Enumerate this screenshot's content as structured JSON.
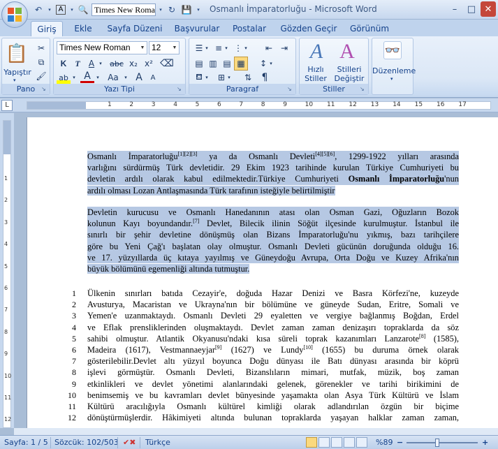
{
  "window": {
    "title": "Osmanlı İmparatorluğu - Microsoft Word",
    "qat_font": "Times New Roman",
    "minimize": "–",
    "maximize": "□",
    "close": "✕"
  },
  "tabs": [
    "Giriş",
    "Ekle",
    "Sayfa Düzeni",
    "Başvurular",
    "Postalar",
    "Gözden Geçir",
    "Görünüm"
  ],
  "ribbon": {
    "pano": {
      "label": "Pano",
      "paste": "Yapıştır"
    },
    "font": {
      "label": "Yazı Tipi",
      "name": "Times New Roman",
      "size": "12",
      "bold": "K",
      "italic": "T",
      "underline": "A",
      "strike": "abc",
      "sub": "x₂",
      "sup": "x²",
      "grow": "A",
      "shrink": "A",
      "case": "Aa"
    },
    "paragraph": {
      "label": "Paragraf",
      "pilcrow": "¶"
    },
    "styles": {
      "label": "Stiller",
      "quick": "Hızlı\nStiller",
      "change": "Stilleri\nDeğiştir"
    },
    "editing": {
      "label": "Düzenleme"
    }
  },
  "ruler": {
    "corner": "L",
    "top_numbers": [
      "1",
      "2",
      "3",
      "4",
      "5",
      "6",
      "7",
      "8",
      "9",
      "10",
      "11",
      "12",
      "13",
      "14",
      "15",
      "16",
      "17"
    ],
    "left_numbers": [
      "1",
      "2",
      "3",
      "4",
      "5",
      "6",
      "7",
      "8",
      "9",
      "10",
      "11",
      "12",
      "13"
    ]
  },
  "document": {
    "para1": [
      "Osmanlı İmparatorluğu[1][2][3] ya da Osmanlı Devleti[4][5][6], 1299-1922 yılları arasında",
      "varlığını sürdürmüş Türk devletidir. 29 Ekim 1923 tarihinde kurulan Türkiye Cumhuriyeti bu",
      "devletin ardılı olarak kabul edilmektedir.Türkiye Cumhuriyeti Osmanlı İmparatorluğu'nun",
      "ardılı olması Lozan Antlaşmasında Türk tarafının isteğiyle belirtilmiştir"
    ],
    "para2": [
      "Devletin kurucusu ve Osmanlı Hanedanının atası olan Osman Gazi, Oğuzların Bozok",
      "kolunun Kayı boyundandır.[7] Devlet, Bilecik ilinin Söğüt ilçesinde kurulmuştur. İstanbul ile",
      "sınırlı bir şehir devletine dönüşmüş olan Bizans İmparatorluğu'nu yıkmış, bazı tarihçilere",
      "göre bu Yeni Çağ'ı başlatan olay olmuştur. Osmanlı Devleti gücünün doruğunda olduğu 16.",
      "ve 17. yüzyıllarda üç kıtaya yayılmış ve Güneydoğu Avrupa, Orta Doğu ve Kuzey Afrika'nın",
      "büyük bölümünü egemenliği altında tutmuştur."
    ],
    "para3": [
      {
        "n": "1",
        "text": "Ülkenin sınırları batıda Cezayir'e, doğuda Hazar Denizi ve Basra Körfezi'ne, kuzeyde"
      },
      {
        "n": "2",
        "text": "Avusturya, Macaristan ve Ukrayna'nın bir bölümüne ve güneyde Sudan, Eritre, Somali ve"
      },
      {
        "n": "3",
        "text": "Yemen'e uzanmaktaydı. Osmanlı Devleti 29 eyaletten ve vergiye bağlanmış Boğdan, Erdel"
      },
      {
        "n": "4",
        "text": "ve Eflak prensliklerinden oluşmaktaydı. Devlet zaman zaman denizaşırı topraklarda da söz"
      },
      {
        "n": "5",
        "text": "sahibi olmuştur. Atlantik Okyanusu'ndaki kısa süreli toprak kazanımları Lanzarote[8] (1585),"
      },
      {
        "n": "6",
        "text": "Madeira (1617), Vestmannaeyjar[9] (1627) ve Lundy[10] (1655) bu duruma örnek olarak"
      },
      {
        "n": "7",
        "text": "gösterilebilir.Devlet altı yüzyıl boyunca Doğu dünyası ile Batı dünyası arasında bir köprü"
      },
      {
        "n": "8",
        "text": "işlevi görmüştür. Osmanlı Devleti, Bizanslıların mimari, mutfak, müzik, boş zaman"
      },
      {
        "n": "9",
        "text": "etkinlikleri ve devlet yönetimi alanlarındaki gelenek, görenekler ve tarihi birikimini de"
      },
      {
        "n": "10",
        "text": "benimsemiş ve bu kavramları devlet bünyesinde yaşamakta olan Asya Türk Kültürü ve İslam"
      },
      {
        "n": "11",
        "text": "Kültürü aracılığıyla Osmanlı kültürel kimliği olarak adlandırılan özgün bir biçime"
      },
      {
        "n": "12",
        "text": "dönüştürmüşlerdir. Hâkimiyeti altında bulunan topraklarda yaşayan halklar zaman zaman,"
      }
    ]
  },
  "status": {
    "page": "Sayfa: 1 / 5",
    "words": "Sözcük: 102/503",
    "language": "Türkçe",
    "zoom": "%89",
    "zoom_minus": "−",
    "zoom_plus": "+"
  },
  "colors": {
    "accent": "#15428b",
    "selection": "#b6c8e3"
  }
}
